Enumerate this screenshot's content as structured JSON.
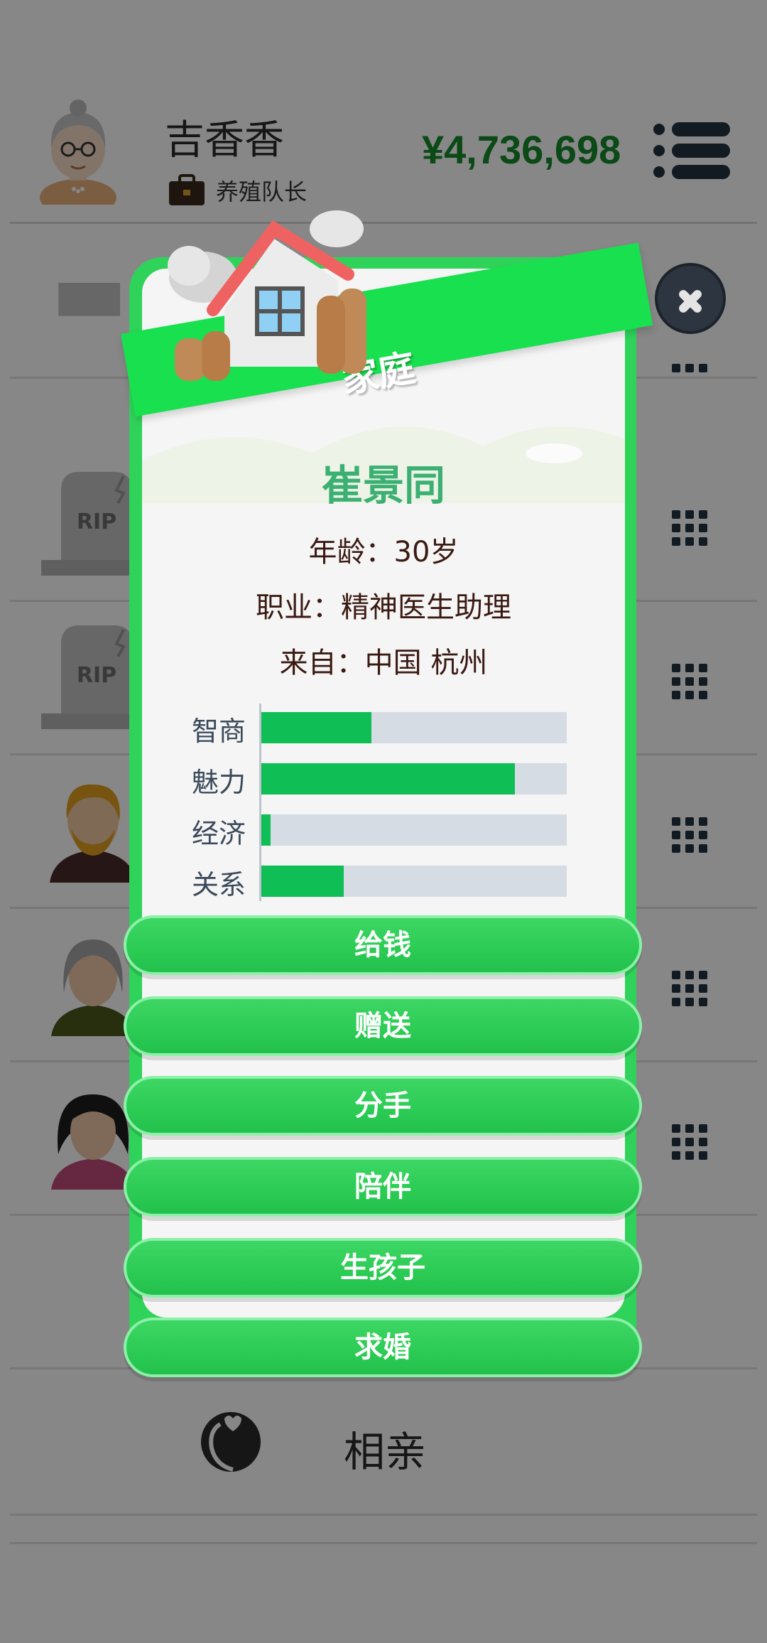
{
  "player": {
    "name": "吉香香",
    "job": "养殖队长",
    "money": "¥4,736,698",
    "avatar_icon": "grandma-avatar-icon",
    "job_icon": "briefcase-icon"
  },
  "list": {
    "rows": [
      {
        "icon": "tombstone-icon"
      },
      {
        "icon": "rip-tombstone-icon",
        "rip_text": "RIP"
      },
      {
        "icon": "rip-tombstone-icon",
        "rip_text": "RIP"
      },
      {
        "icon": "bearded-man-avatar-icon"
      },
      {
        "icon": "gray-haired-woman-avatar-icon"
      },
      {
        "icon": "black-haired-woman-avatar-icon"
      }
    ],
    "action_icon": "grid-menu-icon"
  },
  "bottom_item": {
    "label": "相亲",
    "icon": "heart-couple-icon"
  },
  "modal": {
    "title": "家庭",
    "header_icon": "house-icon",
    "close_icon": "close-icon",
    "person": {
      "name": "崔景同",
      "age_line": "年龄：30岁",
      "job_line": "职业：精神医生助理",
      "from_line": "来自：中国 杭州"
    },
    "stats": [
      {
        "label": "智商",
        "value": 0.36
      },
      {
        "label": "魅力",
        "value": 0.83
      },
      {
        "label": "经济",
        "value": 0.03
      },
      {
        "label": "关系",
        "value": 0.27
      }
    ],
    "actions": [
      "给钱",
      "赠送",
      "分手",
      "陪伴",
      "生孩子",
      "求婚"
    ]
  },
  "colors": {
    "accent_green": "#2fd35a",
    "money_green": "#168a2c",
    "name_green": "#3bb072",
    "stat_fill": "#0fbf56",
    "stat_track": "#d6dce3"
  }
}
